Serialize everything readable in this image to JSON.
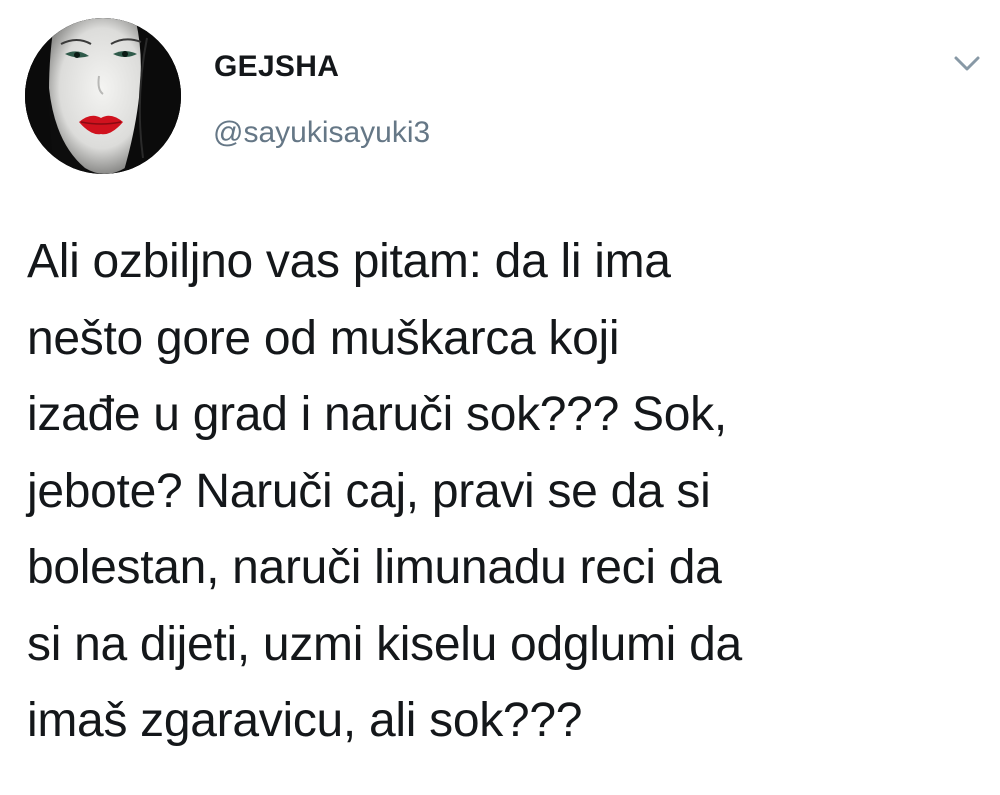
{
  "author": {
    "display_name": "GEJSHA",
    "handle": "@sayukisayuki3"
  },
  "icons": {
    "avatar": "geisha-face-avatar",
    "menu": "chevron-down-icon"
  },
  "tweet": {
    "text": "Ali ozbiljno vas pitam: da li ima\nnešto gore od muškarca koji\nizađe u grad i naruči sok??? Sok,\njebote? Naruči caj, pravi se da si\nbolestan, naruči limunadu reci da\nsi na dijeti, uzmi kiselu odglumi da\nimaš zgaravicu, ali sok???"
  },
  "colors": {
    "name": "#14171a",
    "handle": "#657786",
    "text": "#14171a",
    "caret": "#8899a6",
    "lips": "#d0121e"
  }
}
